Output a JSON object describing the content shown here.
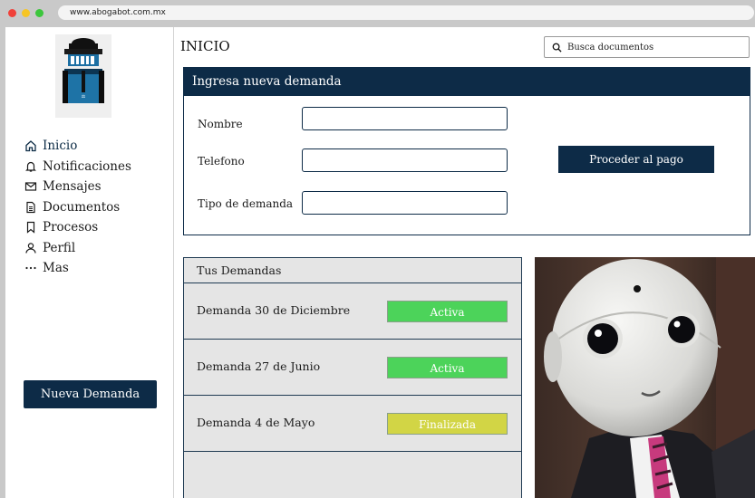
{
  "browser": {
    "url": "www.abogabot.com.mx"
  },
  "sidebar": {
    "items": [
      {
        "label": "Inicio",
        "icon": "home-icon",
        "active": true
      },
      {
        "label": "Notificaciones",
        "icon": "bell-icon",
        "active": false
      },
      {
        "label": "Mensajes",
        "icon": "mail-icon",
        "active": false
      },
      {
        "label": "Documentos",
        "icon": "document-icon",
        "active": false
      },
      {
        "label": "Procesos",
        "icon": "bookmark-icon",
        "active": false
      },
      {
        "label": "Perfil",
        "icon": "user-icon",
        "active": false
      },
      {
        "label": "Mas",
        "icon": "more-icon",
        "active": false
      }
    ],
    "new_button": "Nueva Demanda"
  },
  "header": {
    "title": "INICIO",
    "search_placeholder": "Busca documentos"
  },
  "form": {
    "title": "Ingresa nueva demanda",
    "fields": [
      {
        "label": "Nombre",
        "value": ""
      },
      {
        "label": "Telefono",
        "value": ""
      },
      {
        "label": "Tipo de demanda",
        "value": ""
      }
    ],
    "pay_button": "Proceder al pago"
  },
  "demandas": {
    "title": "Tus Demandas",
    "rows": [
      {
        "name": "Demanda 30 de Diciembre",
        "status": "Activa"
      },
      {
        "name": "Demanda 27 de Junio",
        "status": "Activa"
      },
      {
        "name": "Demanda 4 de Mayo",
        "status": "Finalizada"
      }
    ]
  },
  "colors": {
    "brand_navy": "#0d2b47",
    "status_active": "#4cd35a",
    "status_finished": "#d2d545"
  }
}
